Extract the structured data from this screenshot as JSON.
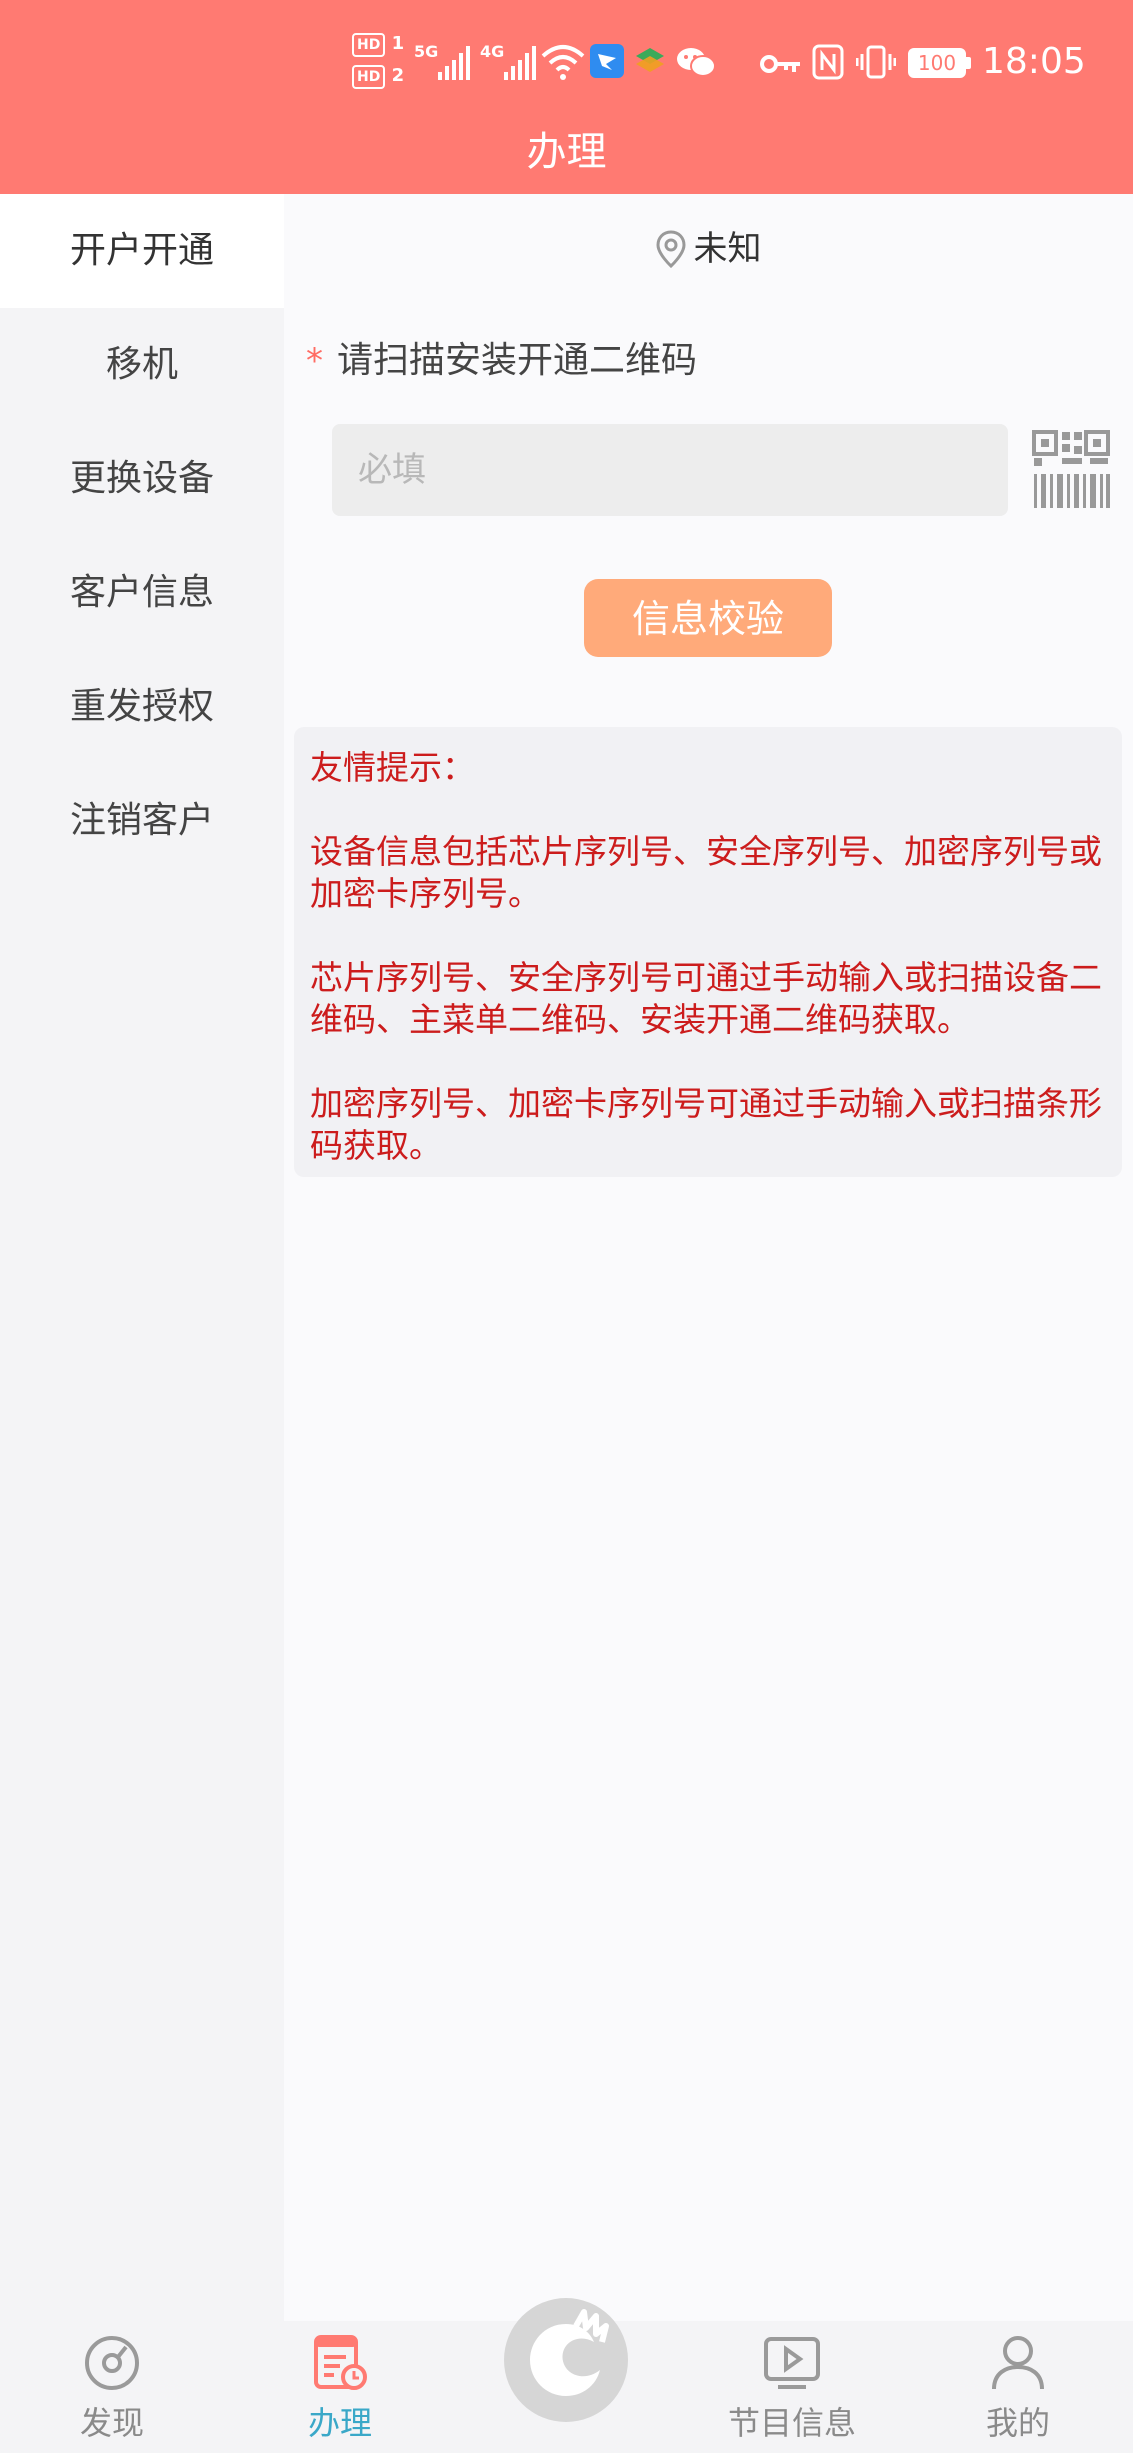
{
  "status_bar": {
    "hd1": "HD",
    "hd1_num": "1",
    "hd2": "HD",
    "hd2_num": "2",
    "net1": "5G",
    "net2": "4G",
    "battery": "100",
    "time": "18:05"
  },
  "header": {
    "title": "办理"
  },
  "sidebar": {
    "items": [
      {
        "label": "开户开通",
        "active": true
      },
      {
        "label": "移机"
      },
      {
        "label": "更换设备"
      },
      {
        "label": "客户信息"
      },
      {
        "label": "重发授权"
      },
      {
        "label": "注销客户"
      }
    ]
  },
  "main": {
    "location": "未知",
    "field": {
      "required_mark": "*",
      "label": "请扫描安装开通二维码",
      "placeholder": "必填",
      "value": ""
    },
    "verify_button": "信息校验",
    "tips": {
      "title": "友情提示：",
      "lines": [
        "设备信息包括芯片序列号、安全序列号、加密序列号或加密卡序列号。",
        "芯片序列号、安全序列号可通过手动输入或扫描设备二维码、主菜单二维码、安装开通二维码获取。",
        "加密序列号、加密卡序列号可通过手动输入或扫描条形码获取。"
      ]
    }
  },
  "bottom_nav": {
    "items": [
      {
        "label": "发现",
        "icon": "compass-icon"
      },
      {
        "label": "办理",
        "icon": "form-clock-icon",
        "active": true
      },
      {
        "label": "节目信息",
        "icon": "play-tv-icon"
      },
      {
        "label": "我的",
        "icon": "user-icon"
      }
    ],
    "center_icon": "app-logo-icon"
  },
  "colors": {
    "header_bg": "#ff7a72",
    "accent_blue": "#3aa8c8",
    "button_bg": "#ffaa7a",
    "tips_text": "#cc1c1c"
  }
}
